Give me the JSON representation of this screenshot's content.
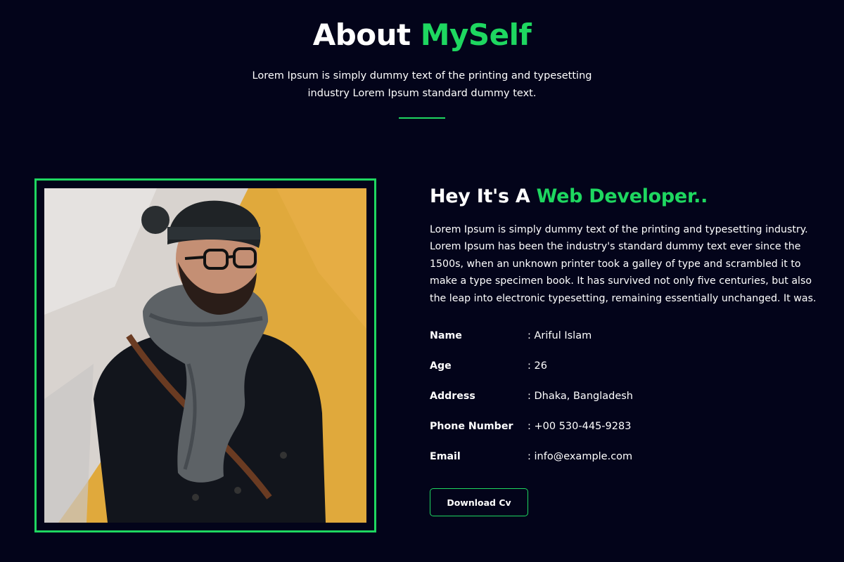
{
  "header": {
    "title_part1": "About",
    "title_part2": "MySelf",
    "subtitle_line1": "Lorem Ipsum is simply dummy text of the printing and typesetting",
    "subtitle_line2": "industry Lorem Ipsum standard dummy text."
  },
  "about": {
    "heading_part1": "Hey It's A",
    "heading_part2": "Web Developer..",
    "paragraph_lines": [
      "Lorem Ipsum is simply dummy text of the printing and typesetting industry.",
      "Lorem Ipsum has been the industry's standard dummy text ever since the",
      "1500s, when an unknown printer took a galley of type and scrambled it to",
      "make a type specimen book. It has survived not only five centuries, but also",
      "the leap into electronic typesetting, remaining essentially unchanged. It was."
    ],
    "info": [
      {
        "key": "Name",
        "value": ": Ariful Islam"
      },
      {
        "key": "Age",
        "value": ": 26"
      },
      {
        "key": "Address",
        "value": ": Dhaka, Bangladesh"
      },
      {
        "key": "Phone Number",
        "value": ": +00 530-445-9283"
      },
      {
        "key": "Email",
        "value": ": info@example.com"
      }
    ],
    "button_label": "Download Cv"
  },
  "colors": {
    "background": "#03041a",
    "accent": "#1ed760",
    "text": "#ffffff"
  }
}
